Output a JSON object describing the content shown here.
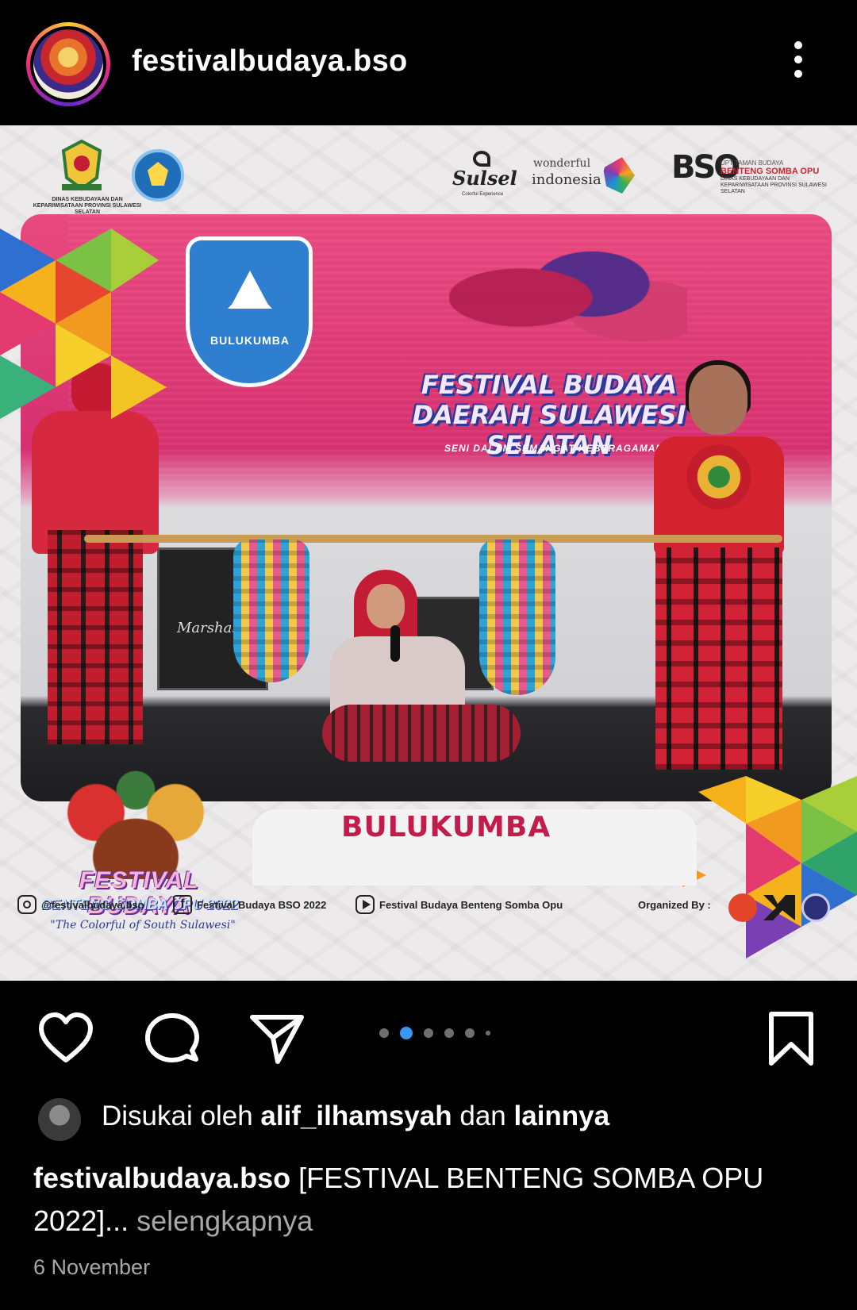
{
  "header": {
    "username": "festivalbudaya.bso",
    "more_icon": "more-vertical-icon"
  },
  "post_image": {
    "top_logos": {
      "pemprov_caption": "DINAS KEBUDAYAAN DAN KEPARIWISATAAN PROVINSI SULAWESI SELATAN",
      "sulsel": "Sulsel",
      "sulsel_tagline": "Colorful Experience",
      "wonderful": "wonderful",
      "indonesia": "indonesia",
      "bso_letters": "BSO",
      "bso_unit": "UPT TAMAN BUDAYA",
      "bso_name": "BENTENG SOMBA OPU",
      "bso_department": "DINAS KEBUDAYAAN DAN KEPARIWISATAAN PROVINSI SULAWESI SELATAN"
    },
    "stage": {
      "emblem_label": "BULUKUMBA",
      "banner_title": "FESTIVAL BUDAYA DAERAH SULAWESI SELATAN",
      "banner_subtitle": "SENI DALAM SEMANGAT KEBERAGAMAN",
      "amp_brand": "Marshall"
    },
    "festival_logo": {
      "title": "FESTIVAL BUDAYA",
      "subtitle": "BENTENG SOMBA OPU 2022",
      "tagline": "\"The Colorful of South Sulawesi\""
    },
    "region_name": "BULUKUMBA",
    "footer": {
      "instagram": "@festivalbudaya.bso",
      "facebook": "Festival Budaya BSO 2022",
      "youtube": "Festival Budaya Benteng Somba Opu",
      "organized_by": "Organized By :"
    }
  },
  "actions": {
    "like_icon": "heart-icon",
    "comment_icon": "comment-icon",
    "share_icon": "send-icon",
    "save_icon": "bookmark-icon",
    "carousel": {
      "count": 6,
      "active_index": 1
    }
  },
  "likes": {
    "prefix": "Disukai oleh",
    "user": "alif_ilhamsyah",
    "connector": "dan",
    "others": "lainnya"
  },
  "caption": {
    "username": "festivalbudaya.bso",
    "text": "[FESTIVAL BENTENG SOMBA OPU 2022]...",
    "more": "selengkapnya"
  },
  "date": "6 November",
  "colors": {
    "background": "#000000",
    "accent_blue": "#3897f0",
    "secondary_text": "#a8a8a8",
    "region_red": "#c21d4a"
  }
}
